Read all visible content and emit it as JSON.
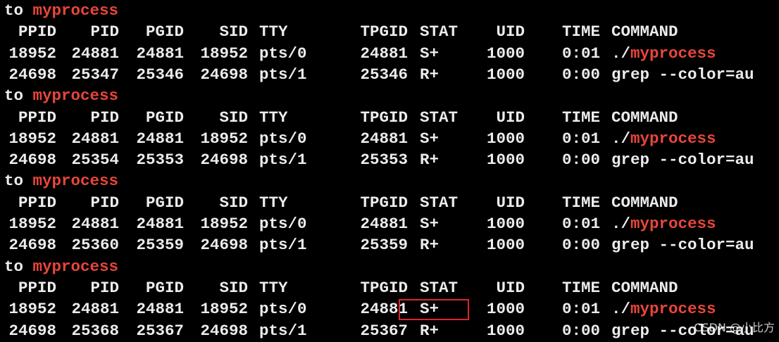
{
  "terminal": {
    "text_color": "#ececec",
    "highlight_color": "#e8463a",
    "background": "#000000",
    "blocks": [
      {
        "to_prefix": "to ",
        "to_name": "myprocess",
        "header": [
          "PPID",
          "PID",
          "PGID",
          "SID",
          "TTY",
          "TPGID",
          "STAT",
          "UID",
          "TIME",
          "COMMAND"
        ],
        "rows": [
          {
            "ppid": "18952",
            "pid": "24881",
            "pgid": "24881",
            "sid": "18952",
            "tty": "pts/0",
            "tpgid": "24881",
            "stat": "S+",
            "uid": "1000",
            "time": "0:01",
            "cmd_prefix": "./",
            "cmd_highlight": "myprocess",
            "cmd_rest": ""
          },
          {
            "ppid": "24698",
            "pid": "25347",
            "pgid": "25346",
            "sid": "24698",
            "tty": "pts/1",
            "tpgid": "25346",
            "stat": "R+",
            "uid": "1000",
            "time": "0:00",
            "cmd_prefix": "grep --color=au",
            "cmd_highlight": "",
            "cmd_rest": ""
          }
        ]
      },
      {
        "to_prefix": "to ",
        "to_name": "myprocess",
        "header": [
          "PPID",
          "PID",
          "PGID",
          "SID",
          "TTY",
          "TPGID",
          "STAT",
          "UID",
          "TIME",
          "COMMAND"
        ],
        "rows": [
          {
            "ppid": "18952",
            "pid": "24881",
            "pgid": "24881",
            "sid": "18952",
            "tty": "pts/0",
            "tpgid": "24881",
            "stat": "S+",
            "uid": "1000",
            "time": "0:01",
            "cmd_prefix": "./",
            "cmd_highlight": "myprocess",
            "cmd_rest": ""
          },
          {
            "ppid": "24698",
            "pid": "25354",
            "pgid": "25353",
            "sid": "24698",
            "tty": "pts/1",
            "tpgid": "25353",
            "stat": "R+",
            "uid": "1000",
            "time": "0:00",
            "cmd_prefix": "grep --color=au",
            "cmd_highlight": "",
            "cmd_rest": ""
          }
        ]
      },
      {
        "to_prefix": "to ",
        "to_name": "myprocess",
        "header": [
          "PPID",
          "PID",
          "PGID",
          "SID",
          "TTY",
          "TPGID",
          "STAT",
          "UID",
          "TIME",
          "COMMAND"
        ],
        "rows": [
          {
            "ppid": "18952",
            "pid": "24881",
            "pgid": "24881",
            "sid": "18952",
            "tty": "pts/0",
            "tpgid": "24881",
            "stat": "S+",
            "uid": "1000",
            "time": "0:01",
            "cmd_prefix": "./",
            "cmd_highlight": "myprocess",
            "cmd_rest": ""
          },
          {
            "ppid": "24698",
            "pid": "25360",
            "pgid": "25359",
            "sid": "24698",
            "tty": "pts/1",
            "tpgid": "25359",
            "stat": "R+",
            "uid": "1000",
            "time": "0:00",
            "cmd_prefix": "grep --color=au",
            "cmd_highlight": "",
            "cmd_rest": ""
          }
        ]
      },
      {
        "to_prefix": "to ",
        "to_name": "myprocess",
        "header": [
          "PPID",
          "PID",
          "PGID",
          "SID",
          "TTY",
          "TPGID",
          "STAT",
          "UID",
          "TIME",
          "COMMAND"
        ],
        "rows": [
          {
            "ppid": "18952",
            "pid": "24881",
            "pgid": "24881",
            "sid": "18952",
            "tty": "pts/0",
            "tpgid": "24881",
            "stat": "S+",
            "uid": "1000",
            "time": "0:01",
            "cmd_prefix": "./",
            "cmd_highlight": "myprocess",
            "cmd_rest": ""
          },
          {
            "ppid": "24698",
            "pid": "25368",
            "pgid": "25367",
            "sid": "24698",
            "tty": "pts/1",
            "tpgid": "25367",
            "stat": "R+",
            "uid": "1000",
            "time": "0:00",
            "cmd_prefix": "grep --color=au",
            "cmd_highlight": "",
            "cmd_rest": ""
          }
        ]
      }
    ]
  },
  "annotation": {
    "box_color": "#e0242c"
  },
  "watermark": {
    "text": "CSDN @小比方"
  }
}
